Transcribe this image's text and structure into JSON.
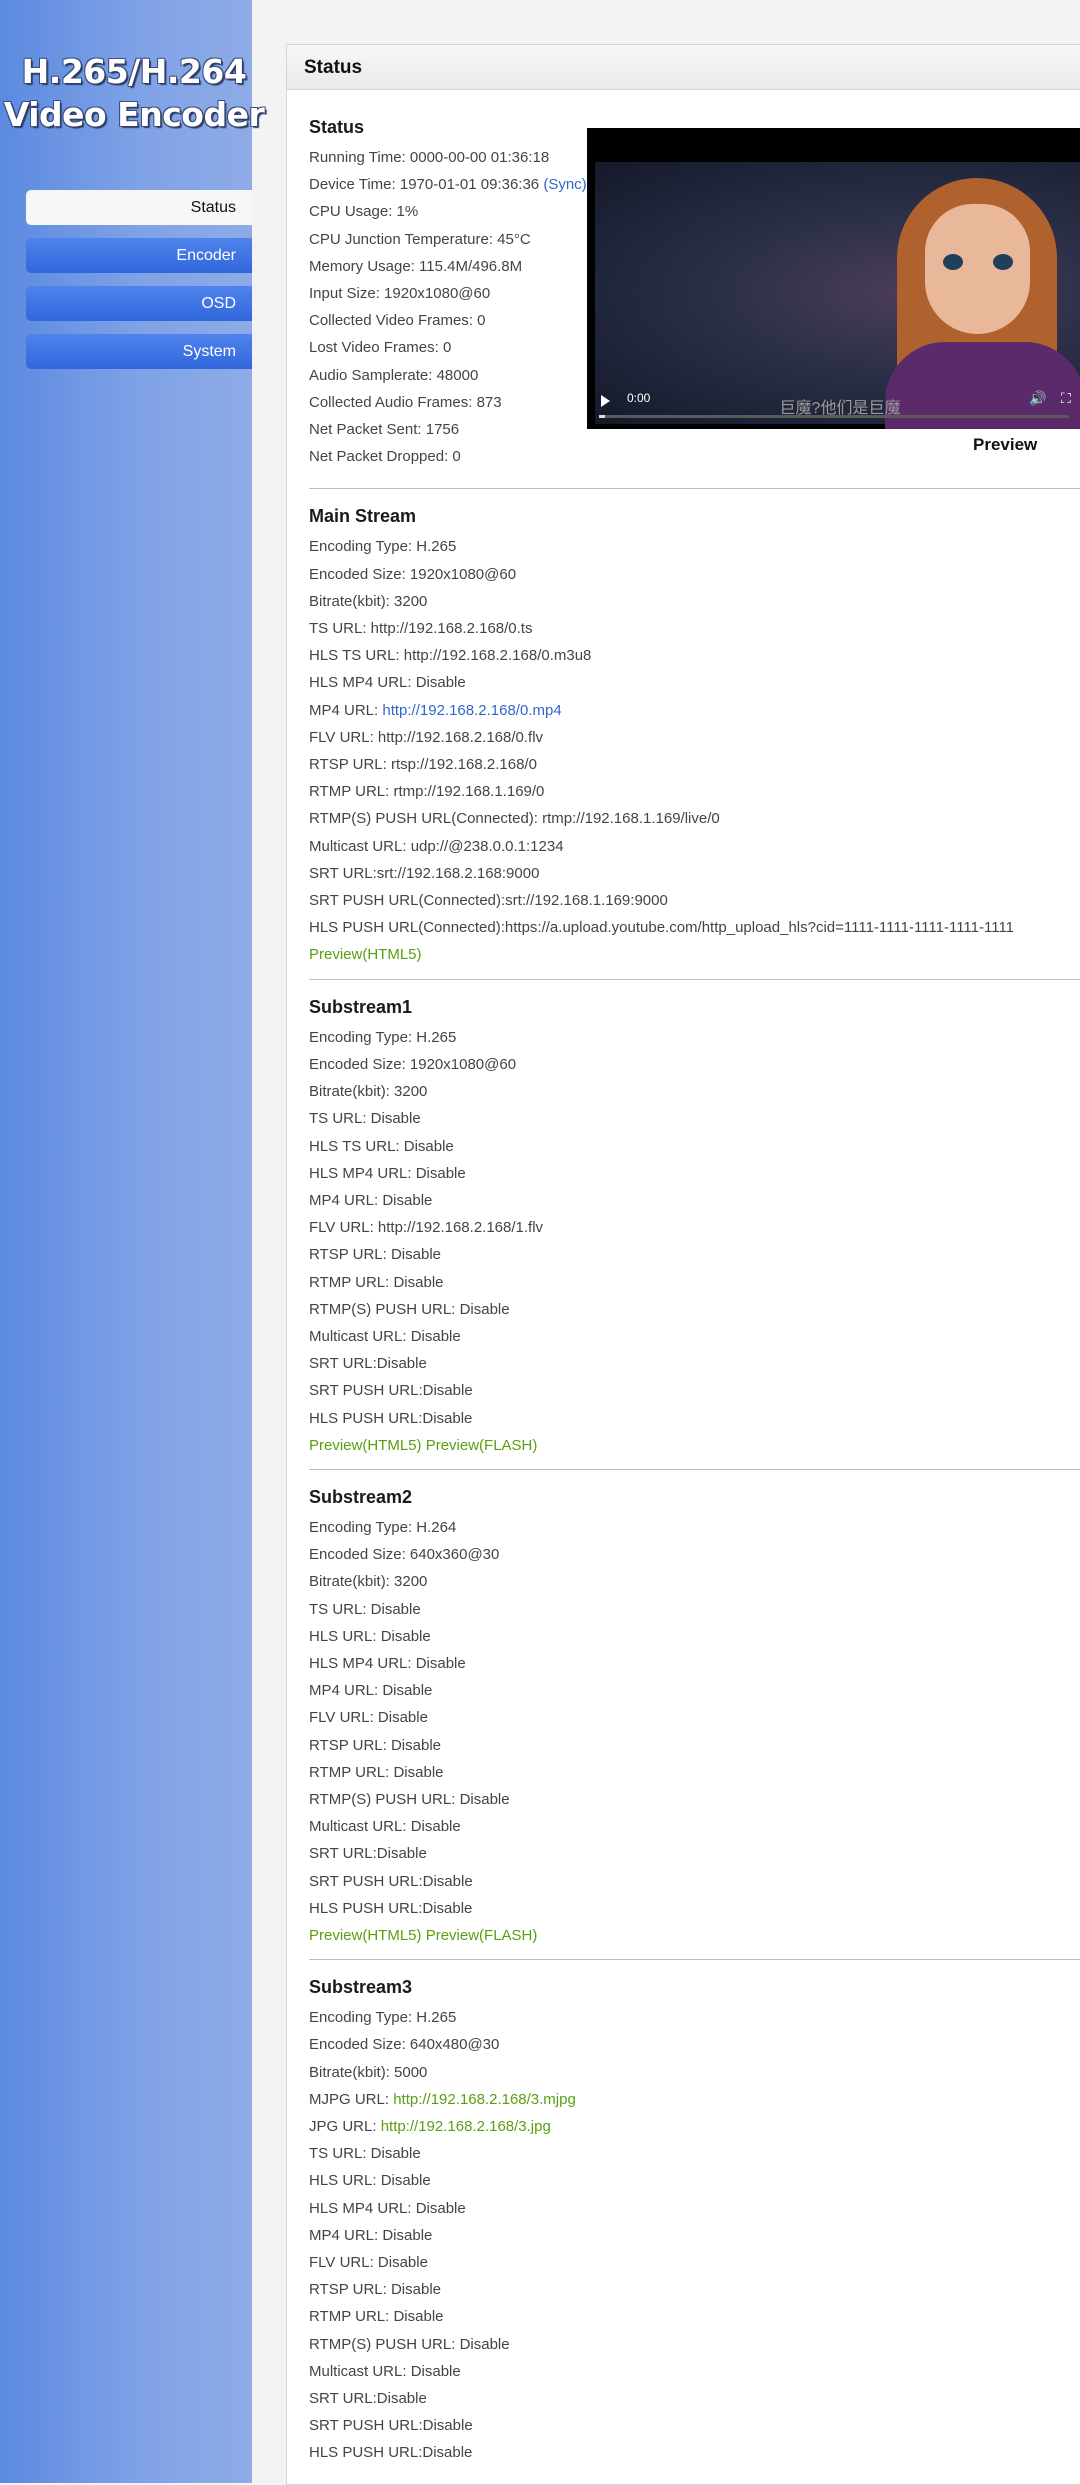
{
  "logo": {
    "line1": "H.265/H.264",
    "line2": "Video Encoder"
  },
  "nav": [
    {
      "label": "Status",
      "active": true
    },
    {
      "label": "Encoder",
      "active": false
    },
    {
      "label": "OSD",
      "active": false
    },
    {
      "label": "System",
      "active": false
    }
  ],
  "panel": {
    "title": "Status"
  },
  "status": {
    "title": "Status",
    "running_time": "Running Time: 0000-00-00 01:36:18",
    "device_time": "Device Time: 1970-01-01 09:36:36",
    "sync_label": "(Sync)",
    "lines": [
      "CPU Usage: 1%",
      "CPU Junction Temperature: 45°C",
      "Memory Usage: 115.4M/496.8M",
      "Input Size: 1920x1080@60",
      "Collected Video Frames: 0",
      "Lost Video Frames: 0",
      "Audio Samplerate: 48000",
      "Collected Audio Frames: 873",
      "Net Packet Sent: 1756",
      "Net Packet Dropped: 0"
    ]
  },
  "video": {
    "time": "0:00",
    "subtitle": "巨魔?他们是巨魔",
    "caption": "Preview",
    "progress_fraction": 0.0
  },
  "main_stream": {
    "title": "Main Stream",
    "lines": [
      "Encoding Type: H.265",
      "Encoded Size: 1920x1080@60",
      "Bitrate(kbit): 3200",
      "TS URL: http://192.168.2.168/0.ts",
      "HLS TS URL: http://192.168.2.168/0.m3u8",
      "HLS MP4 URL: Disable"
    ],
    "mp4_prefix": "MP4 URL: ",
    "mp4_link": "http://192.168.2.168/0.mp4",
    "lines2": [
      "FLV URL: http://192.168.2.168/0.flv",
      "RTSP URL: rtsp://192.168.2.168/0",
      "RTMP URL: rtmp://192.168.1.169/0",
      "RTMP(S) PUSH URL(Connected): rtmp://192.168.1.169/live/0",
      "Multicast URL: udp://@238.0.0.1:1234",
      "SRT URL:srt://192.168.2.168:9000",
      "SRT PUSH URL(Connected):srt://192.168.1.169:9000",
      "HLS PUSH URL(Connected):https://a.upload.youtube.com/http_upload_hls?cid=1111-1111-1111-1111-1111"
    ],
    "preview_html5": "Preview(HTML5)"
  },
  "substream1": {
    "title": "Substream1",
    "lines": [
      "Encoding Type: H.265",
      "Encoded Size: 1920x1080@60",
      "Bitrate(kbit): 3200",
      "TS URL: Disable",
      "HLS TS URL: Disable",
      "HLS MP4 URL: Disable",
      "MP4 URL: Disable",
      "FLV URL: http://192.168.2.168/1.flv",
      "RTSP URL: Disable",
      "RTMP URL: Disable",
      "RTMP(S) PUSH URL: Disable",
      "Multicast URL: Disable",
      "SRT URL:Disable",
      "SRT PUSH URL:Disable",
      "HLS PUSH URL:Disable"
    ],
    "preview_html5": "Preview(HTML5)",
    "preview_flash": "Preview(FLASH)"
  },
  "substream2": {
    "title": "Substream2",
    "lines": [
      "Encoding Type: H.264",
      "Encoded Size: 640x360@30",
      "Bitrate(kbit): 3200",
      "TS URL: Disable",
      "HLS URL: Disable",
      "HLS MP4 URL: Disable",
      "MP4 URL: Disable",
      "FLV URL: Disable",
      "RTSP URL: Disable",
      "RTMP URL: Disable",
      "RTMP(S) PUSH URL: Disable",
      "Multicast URL: Disable",
      "SRT URL:Disable",
      "SRT PUSH URL:Disable",
      "HLS PUSH URL:Disable"
    ],
    "preview_html5": "Preview(HTML5)",
    "preview_flash": "Preview(FLASH)"
  },
  "substream3": {
    "title": "Substream3",
    "lines": [
      "Encoding Type: H.265",
      "Encoded Size: 640x480@30",
      "Bitrate(kbit): 5000"
    ],
    "mjpg_prefix": "MJPG URL: ",
    "mjpg_link": "http://192.168.2.168/3.mjpg",
    "jpg_prefix": "JPG URL: ",
    "jpg_link": "http://192.168.2.168/3.jpg",
    "lines2": [
      "TS URL: Disable",
      "HLS URL: Disable",
      "HLS MP4 URL: Disable",
      "MP4 URL: Disable",
      "FLV URL: Disable",
      "RTSP URL: Disable",
      "RTMP URL: Disable",
      "RTMP(S) PUSH URL: Disable",
      "Multicast URL: Disable",
      "SRT URL:Disable",
      "SRT PUSH URL:Disable",
      "HLS PUSH URL:Disable"
    ]
  }
}
